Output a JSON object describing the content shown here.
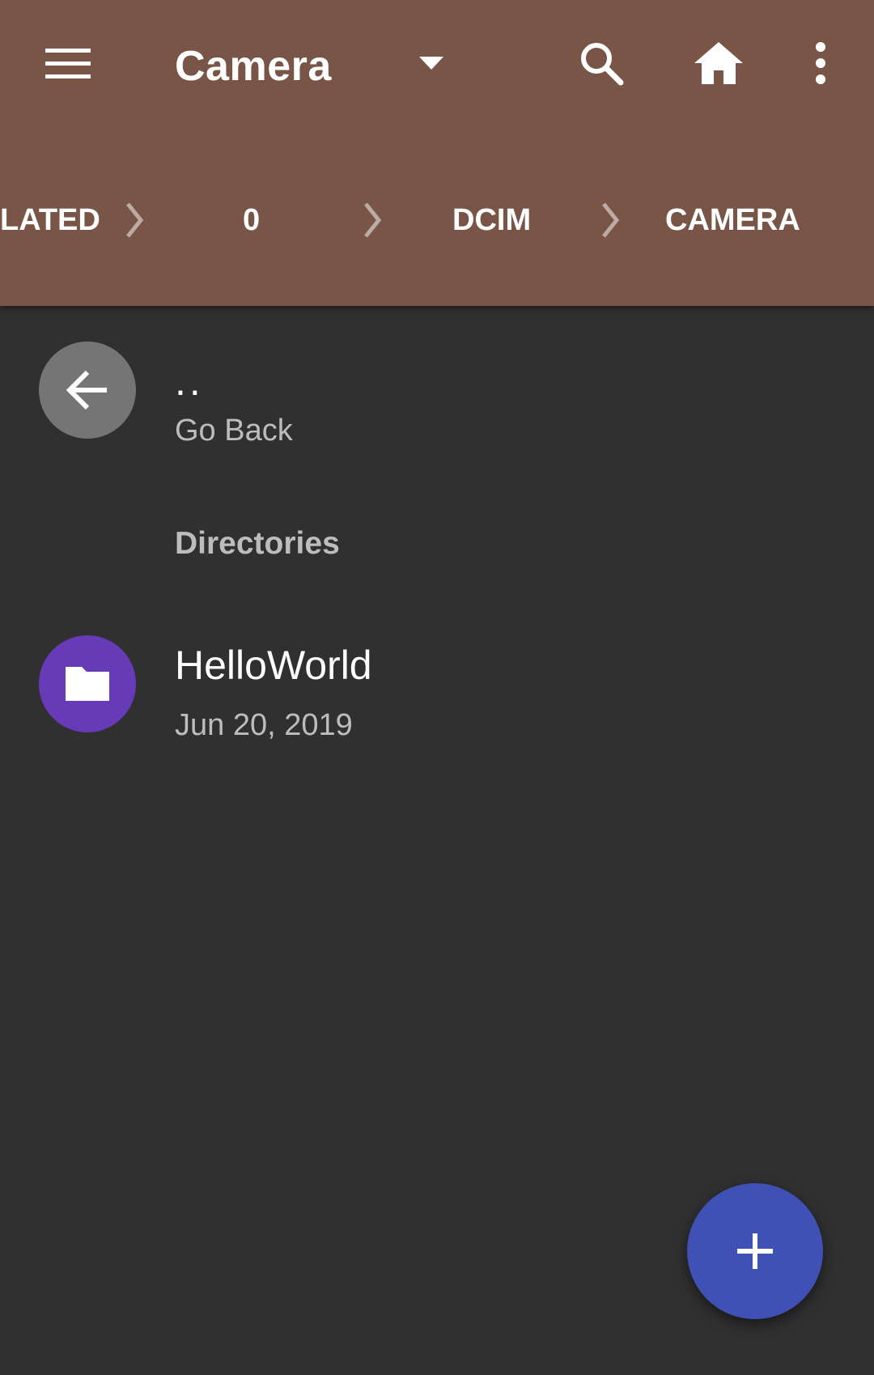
{
  "toolbar": {
    "menu_icon": "menu-icon",
    "title": "Camera",
    "dropdown_icon": "arrow-drop-down-icon",
    "search_icon": "search-icon",
    "home_icon": "home-icon",
    "more_icon": "more-vert-icon"
  },
  "breadcrumbs": {
    "items": [
      "LATED",
      "0",
      "DCIM",
      "CAMERA"
    ],
    "separator_icon": "chevron-right-icon"
  },
  "list": {
    "go_back": {
      "name": "..",
      "subtitle": "Go Back",
      "icon": "arrow-back-icon"
    },
    "section_header": "Directories",
    "directories": [
      {
        "name": "HelloWorld",
        "date": "Jun 20, 2019",
        "icon": "folder-icon"
      }
    ]
  },
  "fab": {
    "icon": "add-icon"
  },
  "colors": {
    "appbar": "#795548",
    "background": "#303030",
    "folder_avatar": "#673ab7",
    "back_avatar": "#757575",
    "fab": "#3f51b5"
  }
}
